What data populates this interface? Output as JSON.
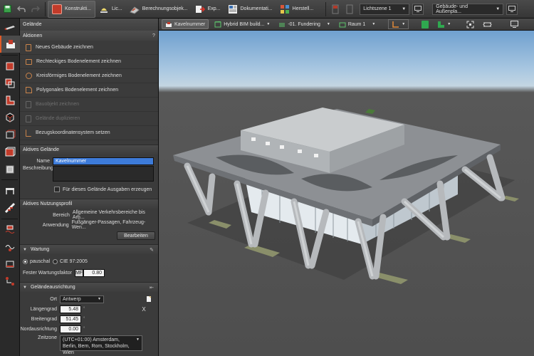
{
  "ribbon": {
    "tabs": [
      {
        "label": "Konstrukti...",
        "icon": "construction-icon",
        "active": true
      },
      {
        "label": "Lic...",
        "icon": "light-icon"
      },
      {
        "label": "Berechnungsobjek...",
        "icon": "calculation-icon"
      },
      {
        "label": "Exp...",
        "icon": "export-icon"
      },
      {
        "label": "Dokumentati...",
        "icon": "documentation-icon"
      },
      {
        "label": "Herstell...",
        "icon": "manufacturer-icon"
      }
    ],
    "light_scene": "Lichtszene 1",
    "view_mode": "Gebäude- und Außenpla..."
  },
  "panel": {
    "title": "Gelände",
    "help": "?",
    "actions_header": "Aktionen",
    "actions": [
      {
        "label": "Neues Gebäude zeichnen",
        "enabled": true
      },
      {
        "label": "Rechteckiges Bodenelement zeichnen",
        "enabled": true
      },
      {
        "label": "Kreisförmiges Bodenelement zeichnen",
        "enabled": true
      },
      {
        "label": "Polygonales Bodenelement zeichnen",
        "enabled": true
      },
      {
        "label": "Bauobjekt zeichnen",
        "enabled": false
      },
      {
        "label": "Gelände duplizieren",
        "enabled": false
      },
      {
        "label": "Bezugskoordinatensystem setzen",
        "enabled": true
      }
    ],
    "terrain_header": "Aktives Gelände",
    "name_label": "Name",
    "name_value": "Kavelnummer",
    "desc_label": "Beschreibung",
    "desc_value": "",
    "output_checkbox": "Für dieses Gelände Ausgaben erzeugen",
    "usage_header": "Aktives Nutzungsprofil",
    "area_label": "Bereich",
    "area_value": "Allgemeine Verkehrsbereiche bis Arb...",
    "application_label": "Anwendung",
    "application_value": "Fußgänger-Passagen, Fahrzeug-Wen...",
    "edit_button": "Bearbeiten",
    "maintenance_header": "Wartung",
    "radio_flat": "pauschal",
    "radio_cie": "CIE 97:2005",
    "fixed_factor_label": "Fester Wartungsfaktor",
    "factor_prefix": "MF",
    "factor_value": "0.80",
    "orientation_header": "Geländeausrichtung",
    "location_label": "Ort",
    "location_value": "Antwerp",
    "longitude_label": "Längengrad",
    "longitude_value": "5.48",
    "latitude_label": "Breitengrad",
    "latitude_value": "51.45",
    "north_label": "Nordausrichtung",
    "north_value": "0.00",
    "degree": "°",
    "timezone_label": "Zeitzone",
    "timezone_value": "(UTC+01:00) Amsterdam, Berlin, Bern, Rom, Stockholm, Wien",
    "close_x": "X"
  },
  "viewbar": {
    "items": [
      {
        "label": "Kavelnummer",
        "icon": "terrain-icon",
        "active": true
      },
      {
        "label": "Hybrid BIM build...",
        "icon": "building-icon"
      },
      {
        "label": "-01. Fundering",
        "icon": "level-icon"
      },
      {
        "label": "Raum 1",
        "icon": "room-icon"
      }
    ]
  },
  "colors": {
    "accent": "#e05a28",
    "selection": "#3d7bd9",
    "green": "#2fa84f"
  }
}
